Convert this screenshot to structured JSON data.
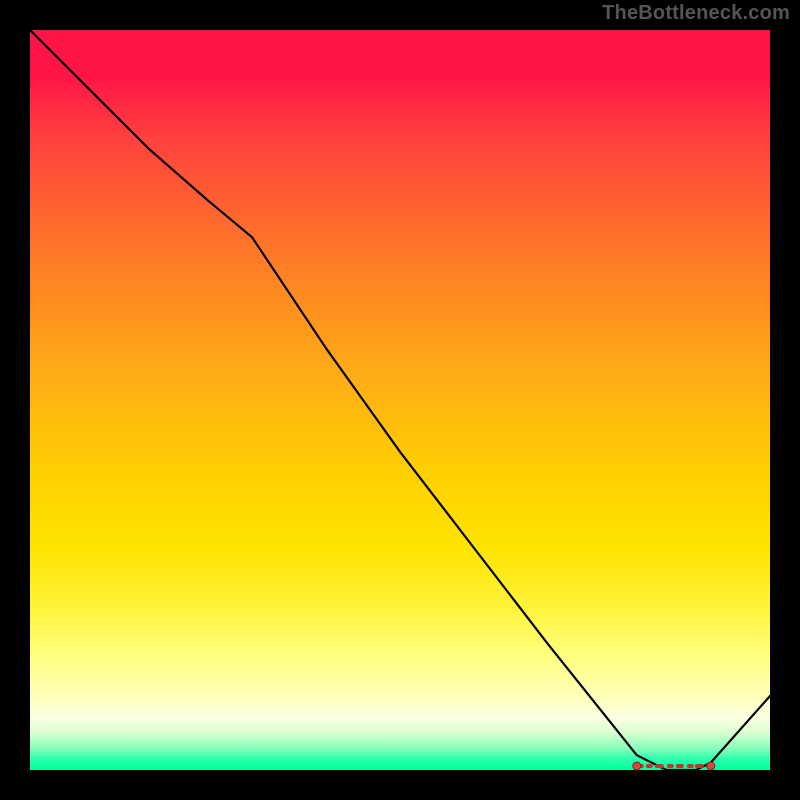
{
  "watermark": "TheBottleneck.com",
  "chart_data": {
    "type": "line",
    "title": "",
    "xlabel": "",
    "ylabel": "",
    "xlim": [
      0,
      100
    ],
    "ylim": [
      0,
      100
    ],
    "grid": false,
    "x": [
      0,
      8,
      16,
      24,
      30,
      40,
      50,
      60,
      70,
      78,
      82,
      86,
      90,
      92,
      100
    ],
    "values": [
      100,
      92,
      84,
      77,
      72,
      57,
      43,
      30,
      17,
      7,
      2,
      0,
      0,
      1,
      10
    ],
    "optimal_range": {
      "x_start": 82,
      "x_end": 92,
      "y": 0
    },
    "endpoint_markers": [
      {
        "x": 82,
        "y": 0
      },
      {
        "x": 92,
        "y": 0
      }
    ],
    "background_gradient": {
      "top": "#ff1447",
      "mid": "#ffe400",
      "bottom": "#00ff9e"
    }
  }
}
